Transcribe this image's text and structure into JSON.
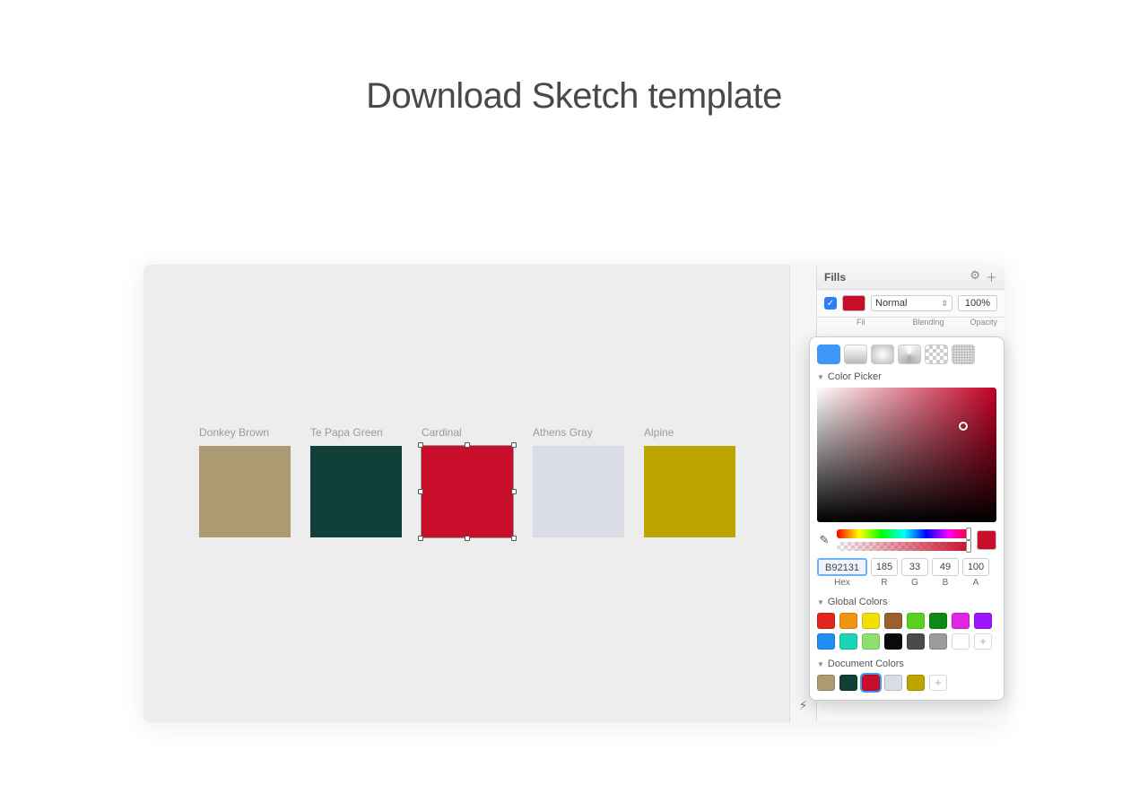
{
  "page_title": "Download Sketch template",
  "swatches": [
    {
      "name": "Donkey Brown",
      "hex": "#ab9a72"
    },
    {
      "name": "Te Papa Green",
      "hex": "#104038"
    },
    {
      "name": "Cardinal",
      "hex": "#c90e2c",
      "selected": true
    },
    {
      "name": "Athens Gray",
      "hex": "#dadce6"
    },
    {
      "name": "Alpine",
      "hex": "#bda400"
    }
  ],
  "inspector": {
    "fills_title": "Fills",
    "fill_row": {
      "checked": true,
      "color_hex": "#c90e2c",
      "blend_mode": "Normal",
      "opacity": "100%"
    },
    "labels": {
      "fill": "Fil",
      "blending": "Blending",
      "opacity": "Opacity"
    }
  },
  "picker": {
    "section_color_picker": "Color Picker",
    "hex": "B92131",
    "r": "185",
    "g": "33",
    "b": "49",
    "a": "100",
    "val_labels": {
      "hex": "Hex",
      "r": "R",
      "g": "G",
      "b": "B",
      "a": "A"
    },
    "section_global": "Global Colors",
    "global_colors": [
      "#e2261e",
      "#f09412",
      "#f2e000",
      "#9a5e2f",
      "#5ad31e",
      "#108a16",
      "#e225e2",
      "#9c17ff",
      "#1f8ef7",
      "#19d6b7",
      "#8de06d",
      "#0b0b0b",
      "#4a4a4a",
      "#9b9b9b",
      "#ffffff"
    ],
    "section_document": "Document Colors",
    "document_colors": [
      "#ab9a72",
      "#104038",
      "#c90e2c",
      "#dadce6",
      "#bda400"
    ]
  }
}
